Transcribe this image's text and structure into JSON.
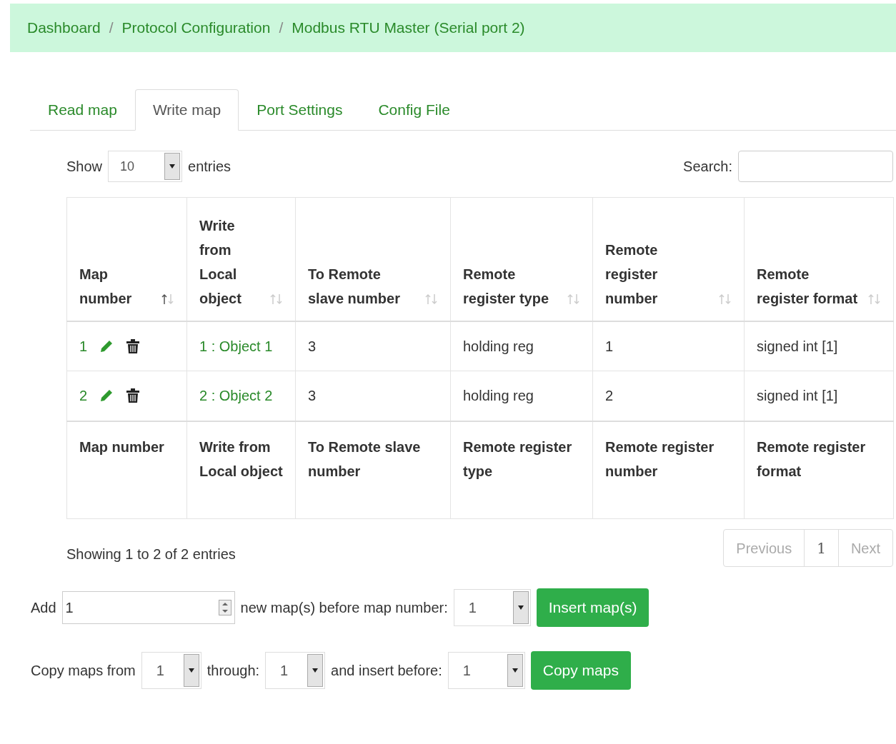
{
  "breadcrumb": {
    "separator": "/",
    "items": [
      {
        "label": "Dashboard"
      },
      {
        "label": "Protocol Configuration"
      },
      {
        "label": "Modbus RTU Master (Serial port 2)"
      }
    ]
  },
  "tabs": [
    {
      "label": "Read map",
      "selected": false
    },
    {
      "label": "Write map",
      "selected": true
    },
    {
      "label": "Port Settings",
      "selected": false
    },
    {
      "label": "Config File",
      "selected": false
    }
  ],
  "length_control": {
    "label_before": "Show",
    "value": "10",
    "label_after": "entries"
  },
  "search": {
    "label": "Search:"
  },
  "table": {
    "columns": [
      {
        "label": "Map number",
        "sorted": true
      },
      {
        "label": "Write from Local object",
        "sorted": false
      },
      {
        "label": "To Remote slave number",
        "sorted": false
      },
      {
        "label": "Remote register type",
        "sorted": false
      },
      {
        "label": "Remote register number",
        "sorted": false
      },
      {
        "label": "Remote register format",
        "sorted": false
      }
    ],
    "rows": [
      {
        "map_number": "1",
        "object": "1 : Object 1",
        "slave": "3",
        "register_type": "holding reg",
        "register_number": "1",
        "format": "signed int [1]"
      },
      {
        "map_number": "2",
        "object": "2 : Object 2",
        "slave": "3",
        "register_type": "holding reg",
        "register_number": "2",
        "format": "signed int [1]"
      }
    ],
    "footer": [
      "Map number",
      "Write from Local object",
      "To Remote slave number",
      "Remote register type",
      "Remote register number",
      "Remote register format"
    ]
  },
  "info": "Showing 1 to 2 of 2 entries",
  "pagination": [
    {
      "kind": "nav",
      "label": "Previous",
      "disabled": true
    },
    {
      "kind": "page",
      "label": "1",
      "disabled": false
    },
    {
      "kind": "nav",
      "label": "Next",
      "disabled": true
    }
  ],
  "add_row": {
    "label": "Add",
    "count": "1",
    "middle": "new map(s) before map number:",
    "before": "1",
    "button": "Insert map(s)"
  },
  "copy_row": {
    "label": "Copy maps from",
    "from": "1",
    "through_label": "through:",
    "through": "1",
    "insert_label": "and insert before:",
    "before": "1",
    "button": "Copy maps"
  }
}
